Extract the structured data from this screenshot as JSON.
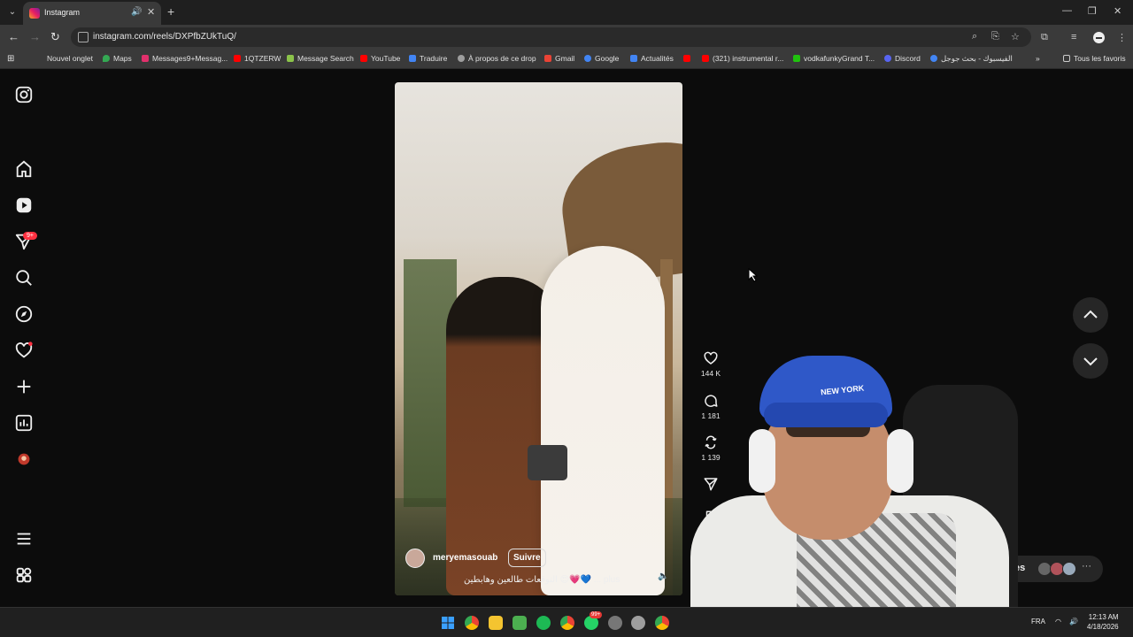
{
  "browser": {
    "tab_title": "Instagram",
    "url": "instagram.com/reels/DXPfbZUkTuQ/",
    "bookmarks": [
      {
        "label": "Nouvel onglet",
        "color": "#9e9e9e"
      },
      {
        "label": "Maps",
        "color": "#34a853"
      },
      {
        "label": "Messages9+Messag...",
        "color": "#e1306c"
      },
      {
        "label": "1QTZERW",
        "color": "#ff0000"
      },
      {
        "label": "Message Search",
        "color": "#8bc34a"
      },
      {
        "label": "YouTube",
        "color": "#ff0000"
      },
      {
        "label": "Traduire",
        "color": "#4285f4"
      },
      {
        "label": "À propos de ce drop",
        "color": "#9e9e9e"
      },
      {
        "label": "Gmail",
        "color": "#ea4335"
      },
      {
        "label": "Google",
        "color": "#4285f4"
      },
      {
        "label": "Actualités",
        "color": "#4285f4"
      },
      {
        "label": "",
        "color": "#ff0000"
      },
      {
        "label": "(321) instrumental r...",
        "color": "#ff0000"
      },
      {
        "label": "vodkafunkyGrand T...",
        "color": "#20c20e"
      },
      {
        "label": "Discord",
        "color": "#5865f2"
      },
      {
        "label": "الفيسبوك - بحث جوجل",
        "color": "#4285f4"
      }
    ],
    "all_bookmarks": "Tous les favoris"
  },
  "sidebar": {
    "notifications_badge": "9+"
  },
  "reel": {
    "username": "meryemasouab",
    "follow_label": "Suivre",
    "caption": "التوقعات طالعين وهابطين 😍💗💙 ... plus",
    "likes": "144 K",
    "comments": "1 181",
    "reposts": "1 139"
  },
  "overlay": {
    "cap_text": "NEW YORK"
  },
  "messages": {
    "label": "sages"
  },
  "taskbar": {
    "lang": "FRA",
    "time": "12:13 AM",
    "date": "4/18/2026",
    "whatsapp_badge": "99+"
  }
}
